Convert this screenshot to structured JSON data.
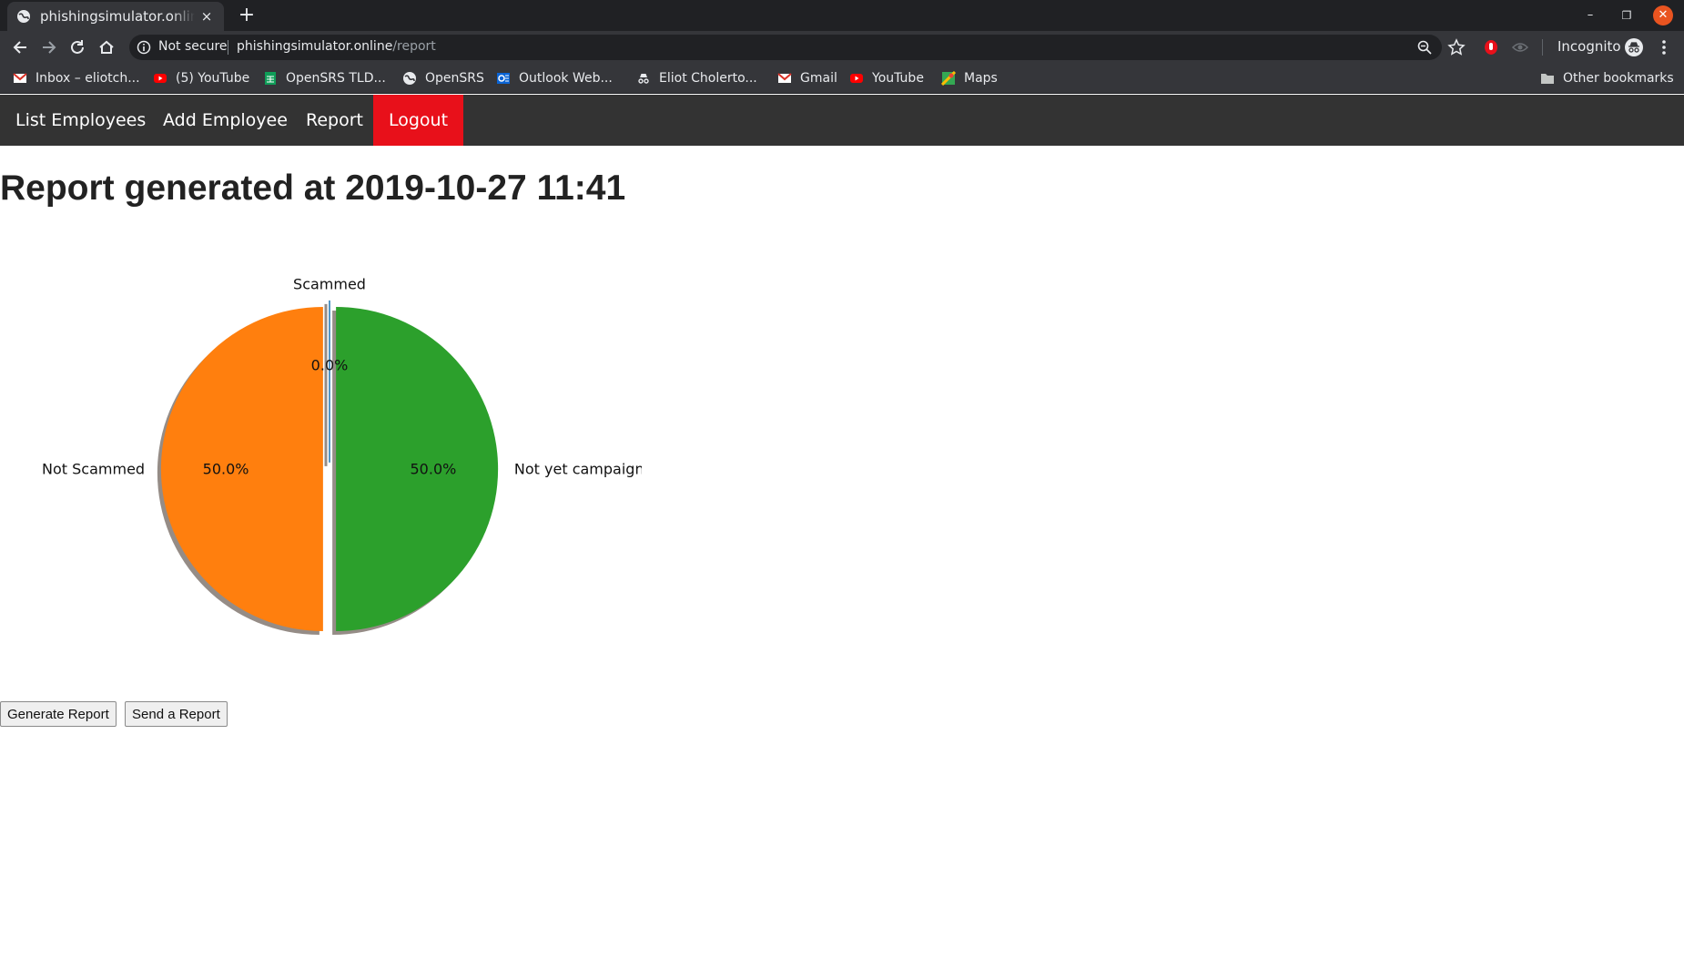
{
  "browser": {
    "tab_title": "phishingsimulator.online/report",
    "tab_close": "×",
    "new_tab": "+",
    "window_controls": {
      "minimize": "–",
      "maximize": "❐",
      "close": "✕"
    },
    "security_label": "Not secure",
    "url_host": "phishingsimulator.online",
    "url_path": "/report",
    "profile_label": "Incognito",
    "bookmarks": [
      {
        "label": "Inbox – eliotch...",
        "icon": "gmail-icon"
      },
      {
        "label": "(5) YouTube",
        "icon": "youtube-icon"
      },
      {
        "label": "OpenSRS TLD...",
        "icon": "sheets-icon"
      },
      {
        "label": "OpenSRS",
        "icon": "globe-icon"
      },
      {
        "label": "Outlook Web...",
        "icon": "outlook-icon"
      },
      {
        "label": "Eliot Cholerto...",
        "icon": "incognito-icon"
      },
      {
        "label": "Gmail",
        "icon": "gmail-icon"
      },
      {
        "label": "YouTube",
        "icon": "youtube-icon"
      },
      {
        "label": "Maps",
        "icon": "maps-icon"
      }
    ],
    "other_bookmarks": "Other bookmarks"
  },
  "nav": {
    "items": [
      {
        "label": "List Employees"
      },
      {
        "label": "Add Employee"
      },
      {
        "label": "Report"
      },
      {
        "label": "Logout"
      }
    ],
    "background_color": "#333333",
    "logout_color": "#e8101a"
  },
  "report": {
    "title": "Report generated at 2019-10-27 11:41"
  },
  "chart_data": {
    "type": "pie",
    "categories": [
      "Scammed",
      "Not Scammed",
      "Not yet campaigned"
    ],
    "values": [
      0.0,
      50.0,
      50.0
    ],
    "percent_labels": [
      "0.0%",
      "50.0%",
      "50.0%"
    ],
    "colors": [
      "#1f77b4",
      "#ff7f0e",
      "#2ca02c"
    ],
    "shadow": true,
    "exploded": true,
    "title": "",
    "legend": "none"
  },
  "buttons": {
    "generate": "Generate Report",
    "send": "Send a Report"
  }
}
